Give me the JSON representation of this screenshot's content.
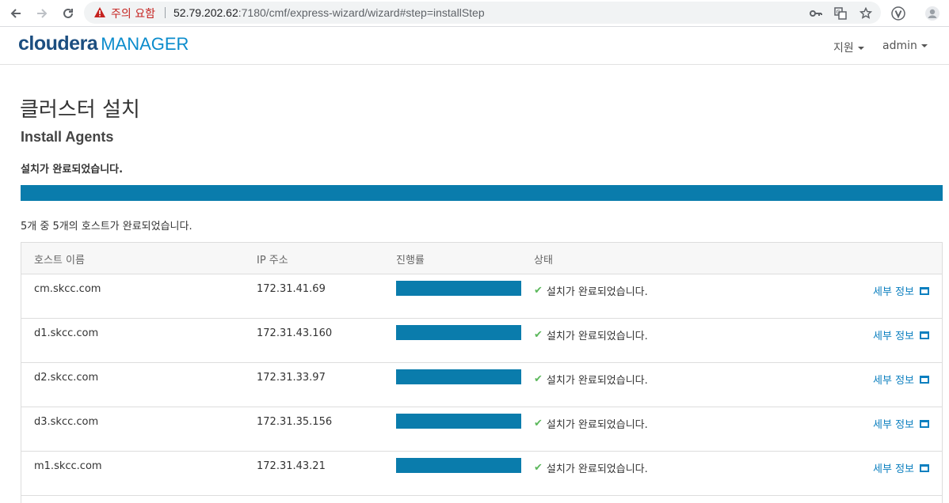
{
  "browser": {
    "security_warning": "주의 요함",
    "url_host": "52.79.202.62",
    "url_rest": ":7180/cmf/express-wizard/wizard#step=installStep"
  },
  "header": {
    "logo_brand": "cloudera",
    "logo_product": "MANAGER",
    "support_menu": "지원",
    "user_menu": "admin"
  },
  "main": {
    "title": "클러스터 설치",
    "subtitle": "Install Agents",
    "status_message": "설치가 완료되었습니다.",
    "progress_percent": 100,
    "host_summary": "5개 중 5개의 호스트가 완료되었습니다."
  },
  "table": {
    "columns": [
      "호스트 이름",
      "IP 주소",
      "진행률",
      "상태"
    ],
    "rows": [
      {
        "host": "cm.skcc.com",
        "ip": "172.31.41.69",
        "progress": 100,
        "status": "설치가 완료되었습니다.",
        "detail": "세부 정보"
      },
      {
        "host": "d1.skcc.com",
        "ip": "172.31.43.160",
        "progress": 100,
        "status": "설치가 완료되었습니다.",
        "detail": "세부 정보"
      },
      {
        "host": "d2.skcc.com",
        "ip": "172.31.33.97",
        "progress": 100,
        "status": "설치가 완료되었습니다.",
        "detail": "세부 정보"
      },
      {
        "host": "d3.skcc.com",
        "ip": "172.31.35.156",
        "progress": 100,
        "status": "설치가 완료되었습니다.",
        "detail": "세부 정보"
      },
      {
        "host": "m1.skcc.com",
        "ip": "172.31.43.21",
        "progress": 100,
        "status": "설치가 완료되었습니다.",
        "detail": "세부 정보"
      }
    ]
  },
  "colors": {
    "progress_fill": "#0a7cac",
    "link": "#0b7fbf",
    "success": "#5cb85c",
    "warning": "#c5221f"
  }
}
